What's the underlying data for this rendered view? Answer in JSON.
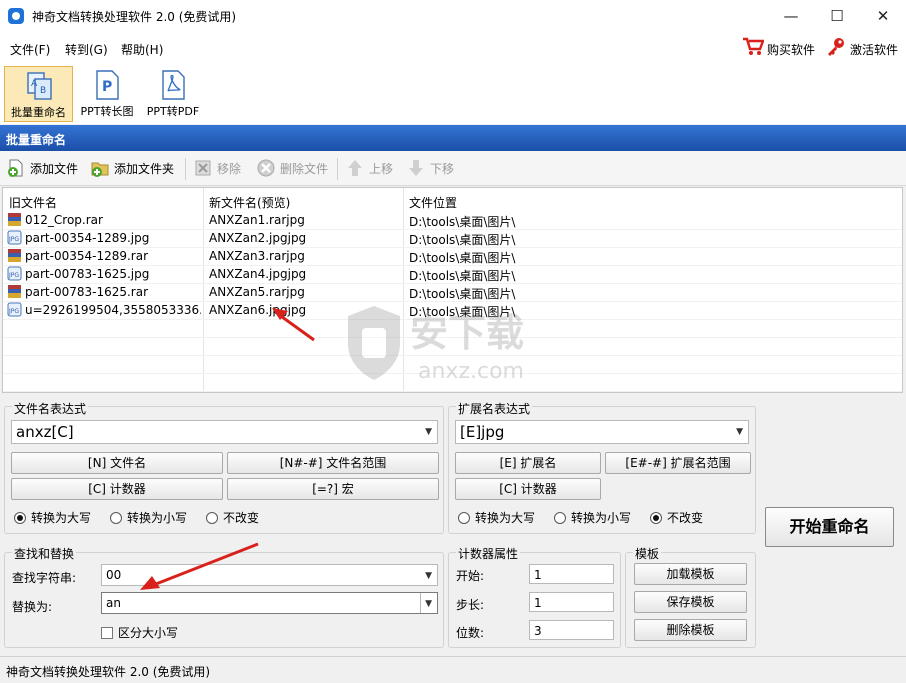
{
  "window": {
    "title": "神奇文档转换处理软件 2.0 (免费试用)",
    "minimize": "—",
    "maximize": "☐",
    "close": "✕"
  },
  "menu": {
    "file": "文件(F)",
    "goto": "转到(G)",
    "help": "帮助(H)",
    "buy": "购买软件",
    "activate": "激活软件"
  },
  "tools": [
    {
      "label": "批量重命名",
      "icon": "rename-icon"
    },
    {
      "label": "PPT转长图",
      "icon": "ppt-icon"
    },
    {
      "label": "PPT转PDF",
      "icon": "pdf-icon"
    }
  ],
  "section_title": "批量重命名",
  "actions": {
    "add_file": "添加文件",
    "add_folder": "添加文件夹",
    "remove": "移除",
    "delete_file": "删除文件",
    "move_up": "上移",
    "move_down": "下移"
  },
  "list": {
    "headers": {
      "old": "旧文件名",
      "new": "新文件名(预览)",
      "location": "文件位置"
    },
    "rows": [
      {
        "old": "012_Crop.rar",
        "new": "ANXZan1.rarjpg",
        "location": "D:\\tools\\桌面\\图片\\",
        "type": "rar"
      },
      {
        "old": "part-00354-1289.jpg",
        "new": "ANXZan2.jpgjpg",
        "location": "D:\\tools\\桌面\\图片\\",
        "type": "jpg"
      },
      {
        "old": "part-00354-1289.rar",
        "new": "ANXZan3.rarjpg",
        "location": "D:\\tools\\桌面\\图片\\",
        "type": "rar"
      },
      {
        "old": "part-00783-1625.jpg",
        "new": "ANXZan4.jpgjpg",
        "location": "D:\\tools\\桌面\\图片\\",
        "type": "jpg"
      },
      {
        "old": "part-00783-1625.rar",
        "new": "ANXZan5.rarjpg",
        "location": "D:\\tools\\桌面\\图片\\",
        "type": "rar"
      },
      {
        "old": "u=2926199504,3558053336...",
        "new": "ANXZan6.jpgjpg",
        "location": "D:\\tools\\桌面\\图片\\",
        "type": "jpg"
      }
    ]
  },
  "filename_expr": {
    "label": "文件名表达式",
    "value": "anxz[C]",
    "buttons": {
      "name": "[N] 文件名",
      "range": "[N#-#] 文件名范围",
      "counter": "[C] 计数器",
      "macro": "[=?] 宏"
    },
    "case": {
      "upper": "转换为大写",
      "lower": "转换为小写",
      "none": "不改变",
      "selected": "upper"
    }
  },
  "ext_expr": {
    "label": "扩展名表达式",
    "value": "[E]jpg",
    "buttons": {
      "ext": "[E] 扩展名",
      "range": "[E#-#] 扩展名范围",
      "counter": "[C] 计数器"
    },
    "case": {
      "upper": "转换为大写",
      "lower": "转换为小写",
      "none": "不改变",
      "selected": "none"
    }
  },
  "start_button": "开始重命名",
  "find_replace": {
    "label": "查找和替换",
    "find_label": "查找字符串:",
    "find_value": "00",
    "replace_label": "替换为:",
    "replace_value": "an",
    "case_sensitive": "区分大小写"
  },
  "counter": {
    "label": "计数器属性",
    "start_label": "开始:",
    "start": "1",
    "step_label": "步长:",
    "step": "1",
    "digits_label": "位数:",
    "digits": "3"
  },
  "template": {
    "label": "模板",
    "load": "加载模板",
    "save": "保存模板",
    "delete": "删除模板"
  },
  "status": "神奇文档转换处理软件 2.0 (免费试用)",
  "watermark": {
    "text_cn": "安下载",
    "text_en": "anxz.com"
  },
  "colors": {
    "accent": "#1b4fa8",
    "arrow": "#d8211b"
  }
}
